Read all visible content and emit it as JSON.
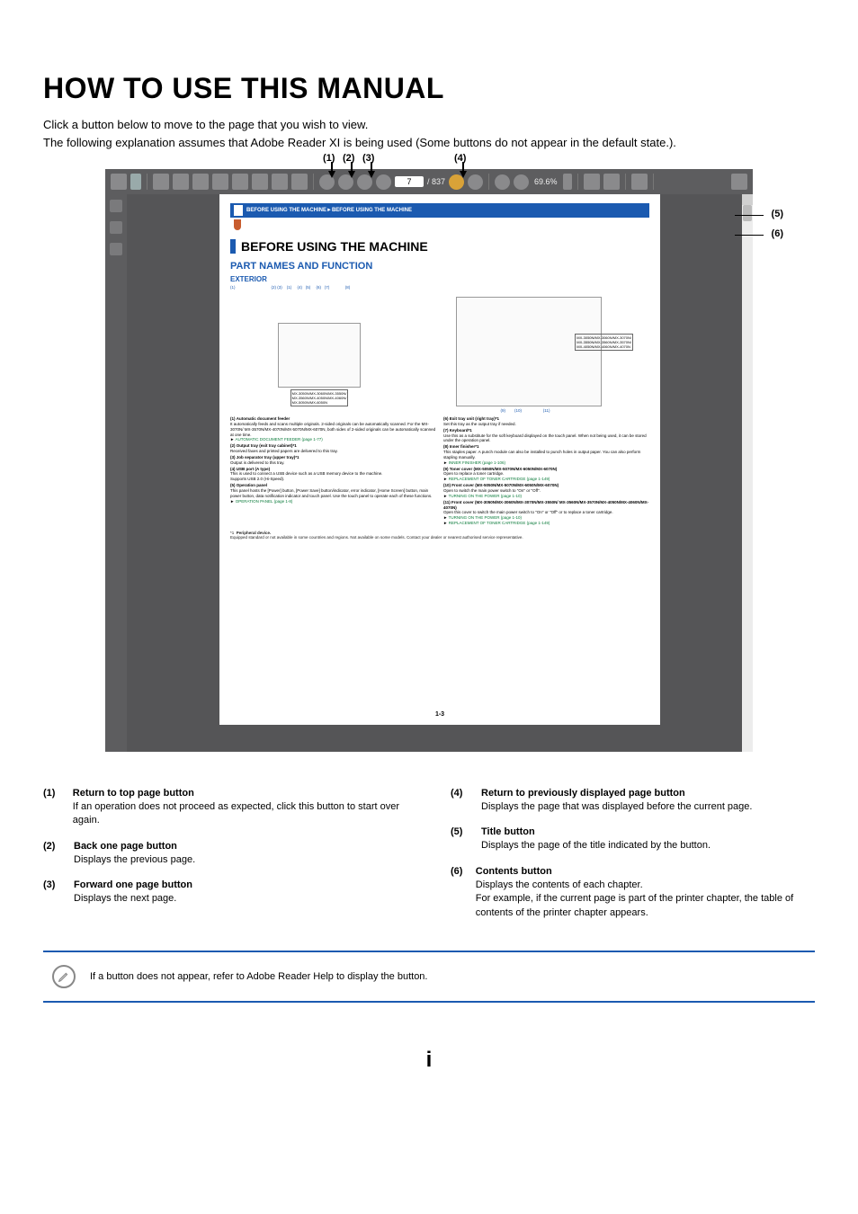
{
  "heading": "HOW TO USE THIS MANUAL",
  "intro1": "Click a button below to move to the page that you wish to view.",
  "intro2": "The following explanation assumes that Adobe Reader XI is being used (Some buttons do not appear in the default state.).",
  "callouts": {
    "c1": "(1)",
    "c2": "(2)",
    "c3": "(3)",
    "c4": "(4)",
    "c5": "(5)",
    "c6": "(6)"
  },
  "toolbar": {
    "page_current": "7",
    "page_total": "/ 837",
    "zoom": "69.6%"
  },
  "manual": {
    "breadcrumb": "BEFORE USING THE MACHINE►BEFORE USING THE MACHINE",
    "h1": "BEFORE USING THE MACHINE",
    "h2": "PART NAMES AND FUNCTION",
    "h3": "EXTERIOR",
    "diag_nums_left": "(1)",
    "diag_nums_right": "(2) (3)    (1)     (4)   (5)     (6)   (7)              (8)",
    "diag_nums_bot": "(9)        (10)                   (11)",
    "model_left": "MX-3050N/MX-3060N/MX-3550N/\nMX-3560N/MX-4050N/MX-4060N/\nMX-5050N/MX-6050N",
    "model_right": "MX-3050N/MX-3060N/MX-3070N/\nMX-3550N/MX-3560N/MX-3570N/\nMX-4050N/MX-4060N/MX-4070N",
    "page_num": "1-3",
    "legend_left": [
      {
        "n": "(1)",
        "t": "Automatic document feeder",
        "d": "It automatically feeds and scans multiple originals. 2-sided originals can be automatically scanned. For the MX-3070N/ MX-3570N/MX-4070N/MX-5070N/MX-6070N, both sides of 2-sided originals can be automatically scanned at one time.",
        "l": "AUTOMATIC DOCUMENT FEEDER (page 1-77)"
      },
      {
        "n": "(2)",
        "t": "Output tray (exit tray cabinet)*1",
        "d": "Received faxes and printed papers are delivered to this tray."
      },
      {
        "n": "(3)",
        "t": "Job separator tray (upper tray)*1",
        "d": "Output is delivered to this tray."
      },
      {
        "n": "(4)",
        "t": "USB port (A type)",
        "d": "This is used to connect a USB device such as a USB memory device to the machine.\nSupports USB 2.0 (Hi-Speed)."
      },
      {
        "n": "(5)",
        "t": "Operation panel",
        "d": "This panel hosts the [Power] button, [Power Save] button/indicator, error indicator, [Home Screen] button, main power button, data notification indicator and touch panel. Use the touch panel to operate each of these functions.",
        "l": "OPERATION PANEL (page 1-8)"
      }
    ],
    "legend_right": [
      {
        "n": "(6)",
        "t": "Exit tray unit (right tray)*1",
        "d": "Set this tray as the output tray if needed."
      },
      {
        "n": "(7)",
        "t": "Keyboard*1",
        "d": "Use this as a substitute for the soft keyboard displayed on the touch panel. When not being used, it can be stored under the operation panel."
      },
      {
        "n": "(8)",
        "t": "Inner finisher*1",
        "d": "This staples paper. A punch module can also be installed to punch holes in output paper. You can also perform stapling manually.",
        "l": "INNER FINISHER (page 1-106)"
      },
      {
        "n": "(9)",
        "t": "Toner cover (MX-5050N/MX-5070N/MX-6050N/MX-6070N)",
        "d": "Open to replace a toner cartridge.",
        "l": "REPLACEMENT OF TONER CARTRIDGE (page 1-149)"
      },
      {
        "n": "(10)",
        "t": "Front cover (MX-5050N/MX-5070N/MX-6050N/MX-6070N)",
        "d": "Open to switch the main power switch to \"On\" or \"Off\".",
        "l": "TURNING ON THE POWER (page 1-10)"
      },
      {
        "n": "(11)",
        "t": "Front cover (MX-3050N/MX-3060N/MX-3070N/MX-3550N/ MX-3560N/MX-3570N/MX-4050N/MX-4060N/MX-4070N)",
        "d": "Open this cover to switch the main power switch to \"On\" or \"Off\" or to replace a toner cartridge.",
        "l": "TURNING ON THE POWER (page 1-10)",
        "l2": "REPLACEMENT OF TONER CARTRIDGE (page 1-149)"
      }
    ],
    "footnote_mark": "*1",
    "footnote_title": "Peripheral device.",
    "footnote_text": "Equipped standard or not available in some countries and regions. Not available on some models. Contact your dealer or nearest authorised service representative."
  },
  "legend": {
    "left": [
      {
        "n": "(1)",
        "t": "Return to top page button",
        "d": "If an operation does not proceed as expected, click this button to start over again."
      },
      {
        "n": "(2)",
        "t": "Back one page button",
        "d": "Displays the previous page."
      },
      {
        "n": "(3)",
        "t": "Forward one page button",
        "d": "Displays the next page."
      }
    ],
    "right": [
      {
        "n": "(4)",
        "t": "Return to previously displayed page button",
        "d": "Displays the page that was displayed before the current page."
      },
      {
        "n": "(5)",
        "t": "Title button",
        "d": "Displays the page of the title indicated by the button."
      },
      {
        "n": "(6)",
        "t": "Contents button",
        "d": "Displays the contents of each chapter.\nFor example, if the current page is part of the printer chapter, the table of contents of the printer chapter appears."
      }
    ]
  },
  "note": "If a button does not appear, refer to Adobe Reader Help to display the button.",
  "footer_page": "i"
}
